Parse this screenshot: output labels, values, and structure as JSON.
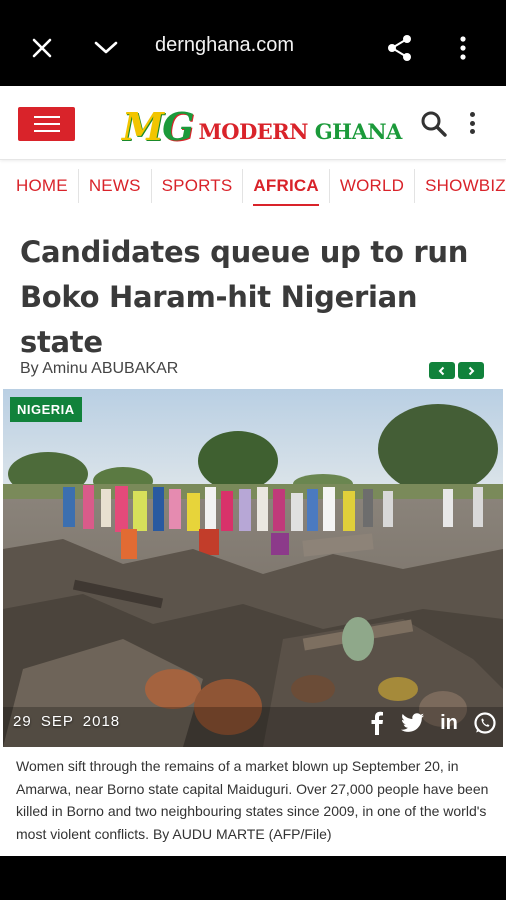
{
  "browser": {
    "url": "dernghana.com",
    "icons": [
      "close-icon",
      "chevron-down-icon",
      "share-icon",
      "more-vert-icon"
    ]
  },
  "site": {
    "logo_mark": "MG",
    "logo_word1": "MODERN",
    "logo_word2": "GHANA",
    "brand_red": "#d9232a",
    "brand_green": "#11823b",
    "brand_yellow": "#f2c500"
  },
  "nav": {
    "items": [
      "HOME",
      "NEWS",
      "SPORTS",
      "AFRICA",
      "WORLD",
      "SHOWBIZ"
    ],
    "active": "AFRICA"
  },
  "article": {
    "headline": "Candidates queue up to run Boko Haram-hit Nigerian state",
    "byline": "By Aminu ABUBAKAR",
    "category_badge": "NIGERIA",
    "date": "29 SEP 2018",
    "share_icons": [
      "facebook-icon",
      "twitter-icon",
      "linkedin-icon",
      "whatsapp-icon"
    ],
    "caption": "Women sift through the remains of a market blown up September 20, in Amarwa, near Borno state capital Maiduguri. Over 27,000 people have been killed in Borno and two neighbouring states since 2009, in one of the world's most violent conflicts. By AUDU MARTE (AFP/File)"
  }
}
